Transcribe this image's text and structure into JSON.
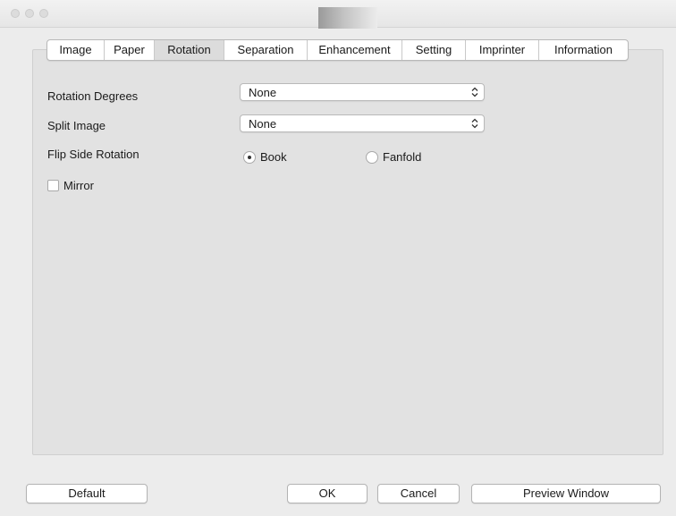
{
  "window": {
    "controls": [
      "close",
      "minimize",
      "zoom"
    ]
  },
  "tabs": [
    "Image",
    "Paper",
    "Rotation",
    "Separation",
    "Enhancement",
    "Setting",
    "Imprinter",
    "Information"
  ],
  "active_tab": "Rotation",
  "form": {
    "rotation_degrees": {
      "label": "Rotation Degrees",
      "value": "None"
    },
    "split_image": {
      "label": "Split Image",
      "value": "None"
    },
    "flip_side_rotation": {
      "label": "Flip Side Rotation",
      "options": [
        {
          "label": "Book",
          "selected": true
        },
        {
          "label": "Fanfold",
          "selected": false
        }
      ]
    },
    "mirror": {
      "label": "Mirror",
      "checked": false
    }
  },
  "buttons": {
    "default": "Default",
    "ok": "OK",
    "cancel": "Cancel",
    "preview": "Preview Window"
  }
}
